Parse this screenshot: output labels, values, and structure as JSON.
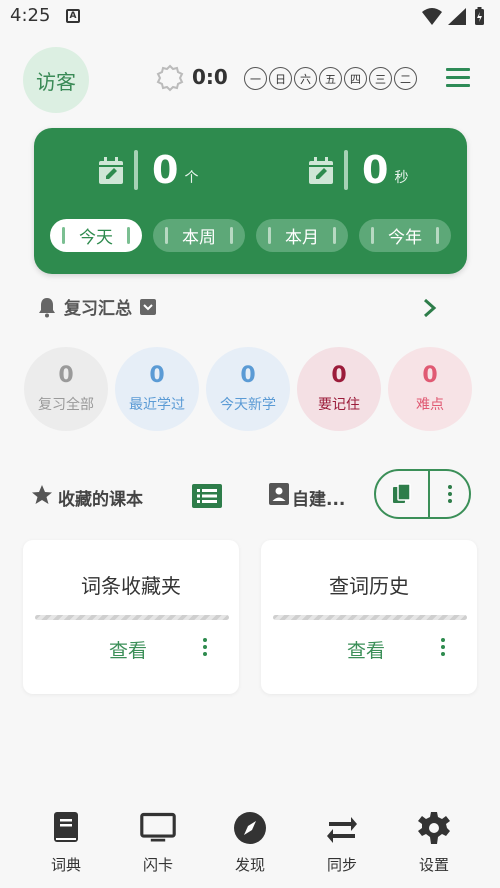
{
  "status_bar": {
    "time": "4:25",
    "notification_glyph": "A"
  },
  "header": {
    "avatar_label": "访客",
    "score": "0:0",
    "weekdays": [
      "一",
      "日",
      "六",
      "五",
      "四",
      "三",
      "二"
    ]
  },
  "stats": {
    "count_value": "0",
    "count_unit": "个",
    "time_value": "0",
    "time_unit": "秒",
    "periods": [
      "今天",
      "本周",
      "本月",
      "今年"
    ],
    "active_period": "今天"
  },
  "review": {
    "title": "复习汇总",
    "items": [
      {
        "count": "0",
        "label": "复习全部",
        "color": "#9a9a9a",
        "bg": "#ececec"
      },
      {
        "count": "0",
        "label": "最近学过",
        "color": "#5b9bd5",
        "bg": "#e6eef7"
      },
      {
        "count": "0",
        "label": "今天新学",
        "color": "#5b9bd5",
        "bg": "#e6eef7"
      },
      {
        "count": "0",
        "label": "要记住",
        "color": "#9b1c3a",
        "bg": "#f4e0e4"
      },
      {
        "count": "0",
        "label": "难点",
        "color": "#e05a73",
        "bg": "#f7e3e6"
      }
    ]
  },
  "collections": {
    "title": "收藏的课本",
    "self_built_label": "自建..."
  },
  "cards": [
    {
      "title": "词条收藏夹",
      "action": "查看"
    },
    {
      "title": "查词历史",
      "action": "查看"
    }
  ],
  "nav": [
    {
      "label": "词典",
      "icon": "book-icon"
    },
    {
      "label": "闪卡",
      "icon": "monitor-icon"
    },
    {
      "label": "发现",
      "icon": "compass-icon"
    },
    {
      "label": "同步",
      "icon": "sync-arrows-icon"
    },
    {
      "label": "设置",
      "icon": "gear-icon"
    }
  ],
  "colors": {
    "primary": "#2e8b4e",
    "accent_light": "#dcefe2"
  }
}
